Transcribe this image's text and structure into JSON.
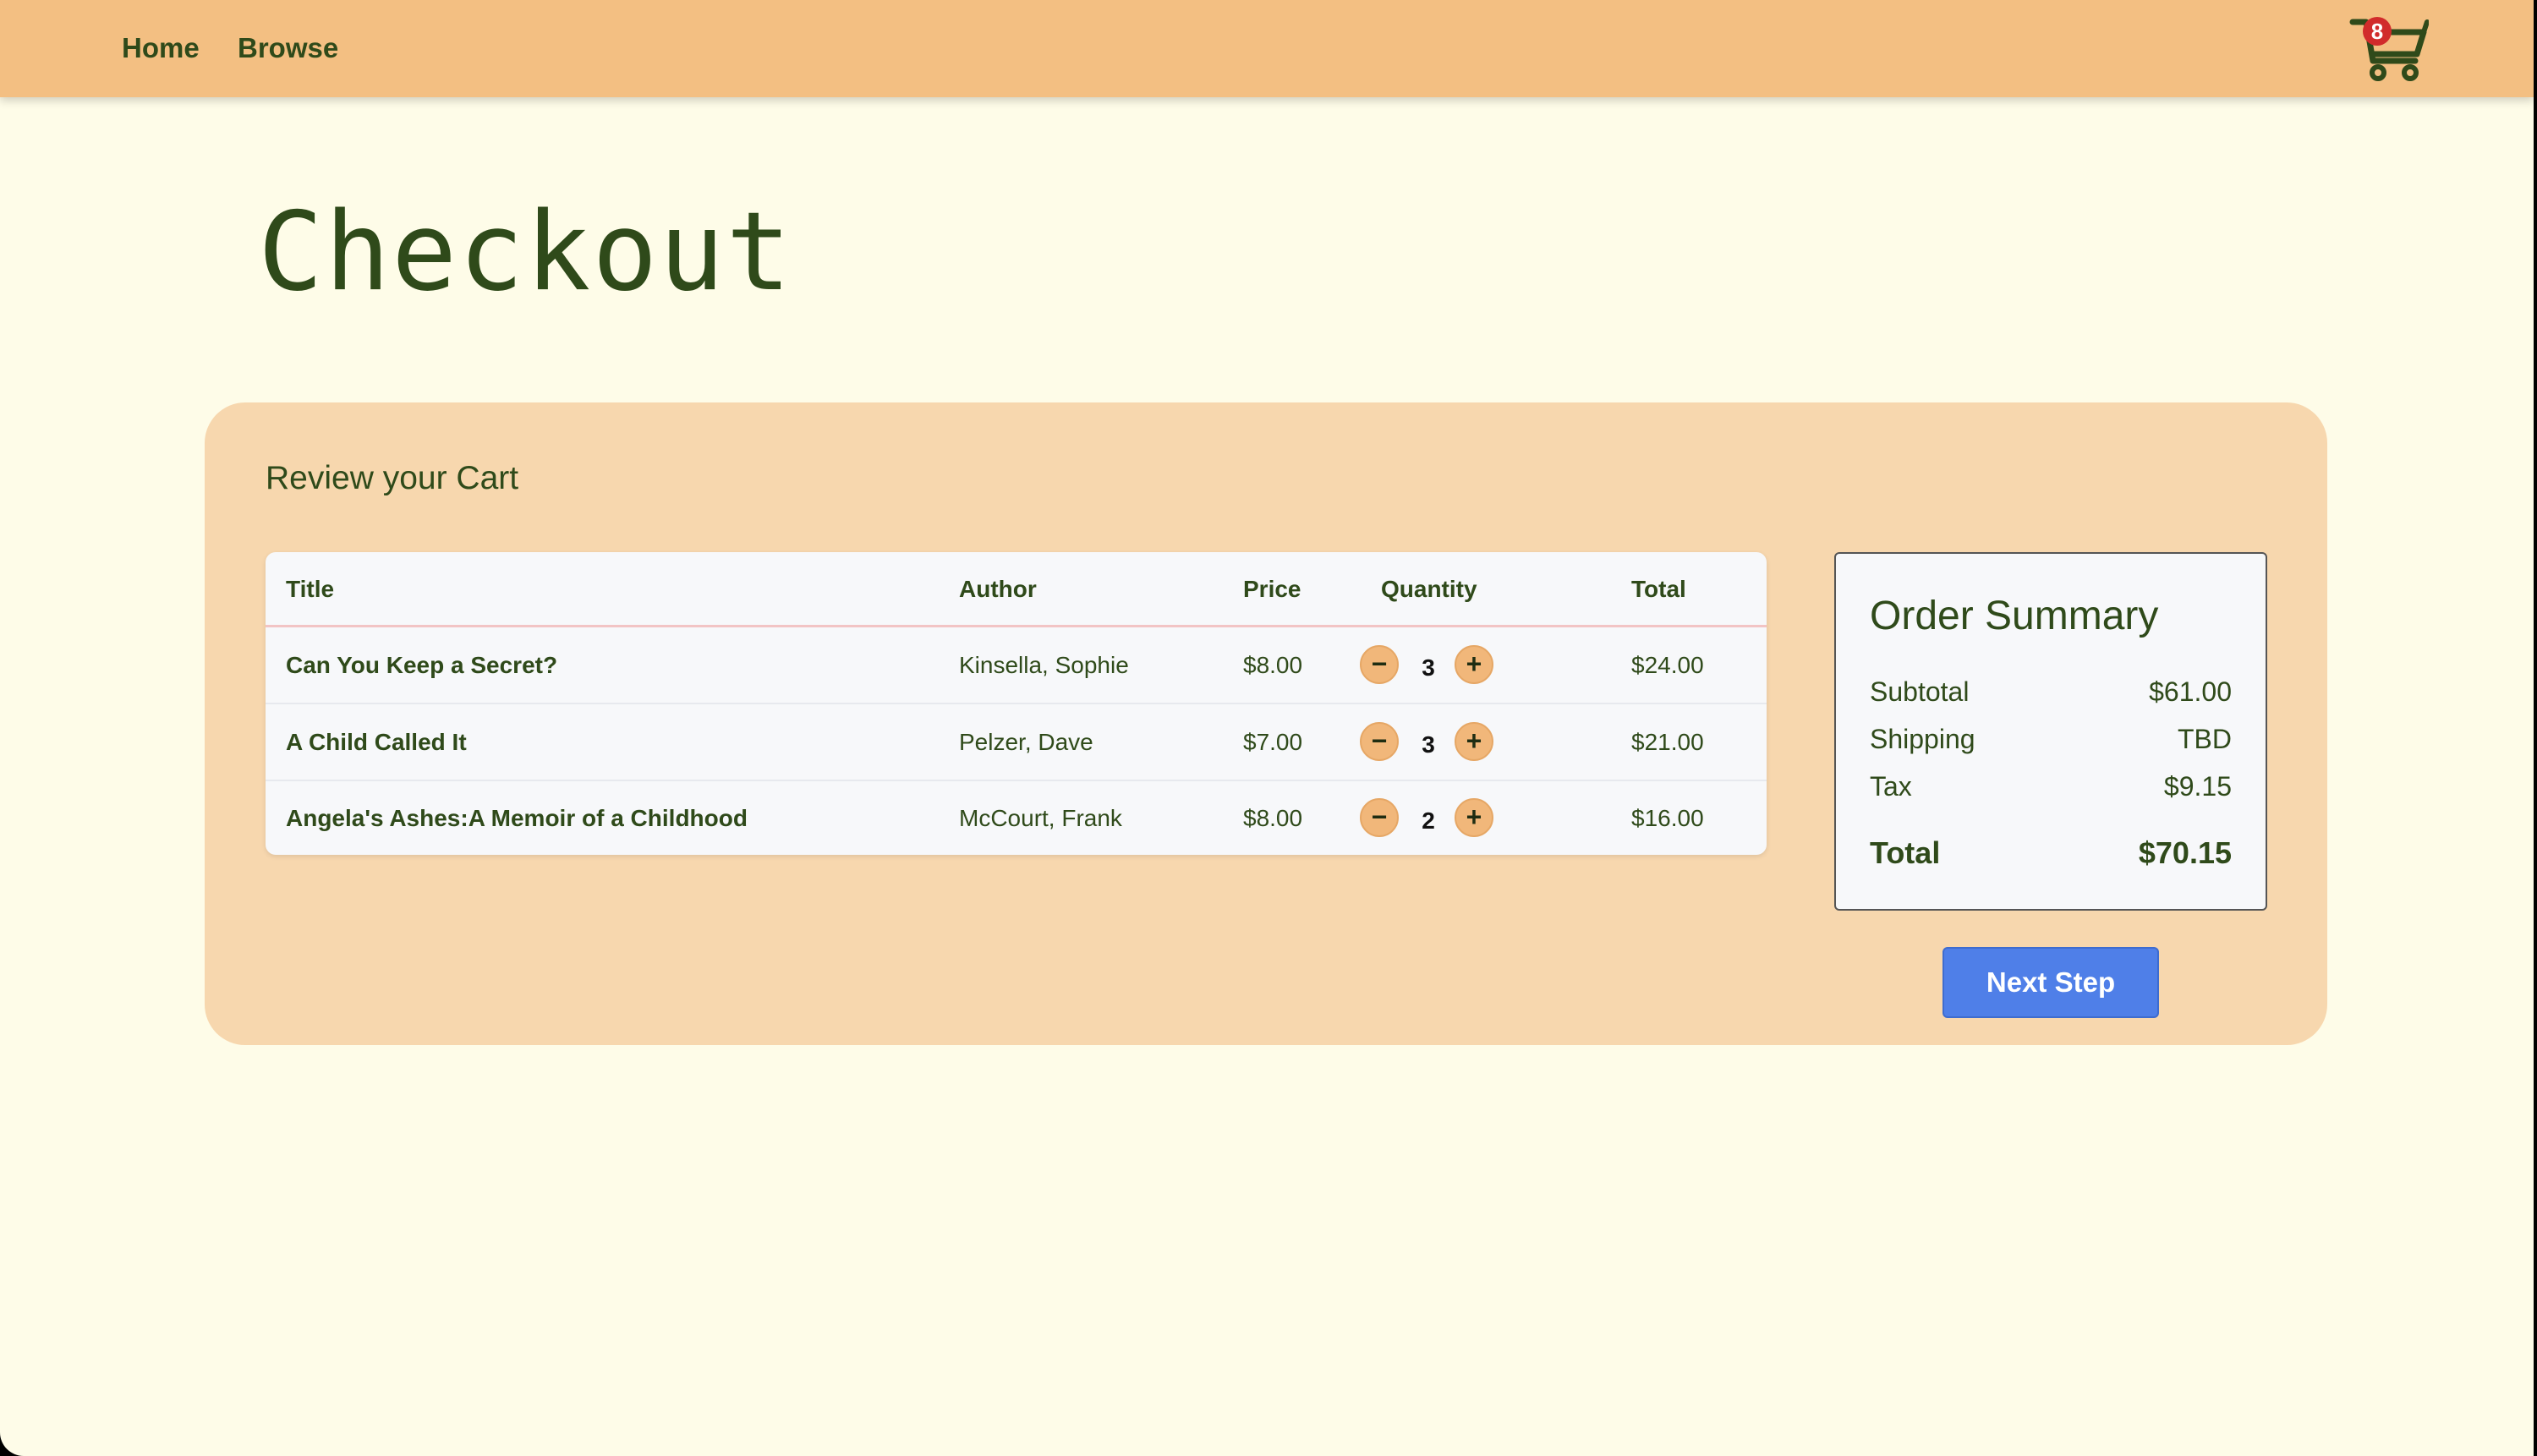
{
  "nav": {
    "links": [
      "Home",
      "Browse"
    ],
    "cart_count": "8"
  },
  "page_title": "Checkout",
  "cart": {
    "heading": "Review your Cart",
    "columns": {
      "title": "Title",
      "author": "Author",
      "price": "Price",
      "quantity": "Quantity",
      "total": "Total"
    },
    "rows": [
      {
        "title": "Can You Keep a Secret?",
        "author": "Kinsella, Sophie",
        "price": "$8.00",
        "quantity": "3",
        "total": "$24.00"
      },
      {
        "title": "A Child Called It",
        "author": "Pelzer, Dave",
        "price": "$7.00",
        "quantity": "3",
        "total": "$21.00"
      },
      {
        "title": "Angela's Ashes:A Memoir of a Childhood",
        "author": "McCourt, Frank",
        "price": "$8.00",
        "quantity": "2",
        "total": "$16.00"
      }
    ],
    "minus_symbol": "−",
    "plus_symbol": "+"
  },
  "summary": {
    "title": "Order Summary",
    "subtotal_label": "Subtotal",
    "subtotal_value": "$61.00",
    "shipping_label": "Shipping",
    "shipping_value": "TBD",
    "tax_label": "Tax",
    "tax_value": "$9.15",
    "total_label": "Total",
    "total_value": "$70.15"
  },
  "actions": {
    "next_step_label": "Next Step"
  },
  "colors": {
    "navbar": "#f3bf82",
    "page_background": "#fefce8",
    "card_background": "#f7d7ae",
    "text": "#2f4a1a",
    "primary_button": "#4f7fe8",
    "badge": "#d12b2b",
    "qty_button": "#f1b77a"
  },
  "icons": {
    "cart": "shopping-cart-icon"
  }
}
